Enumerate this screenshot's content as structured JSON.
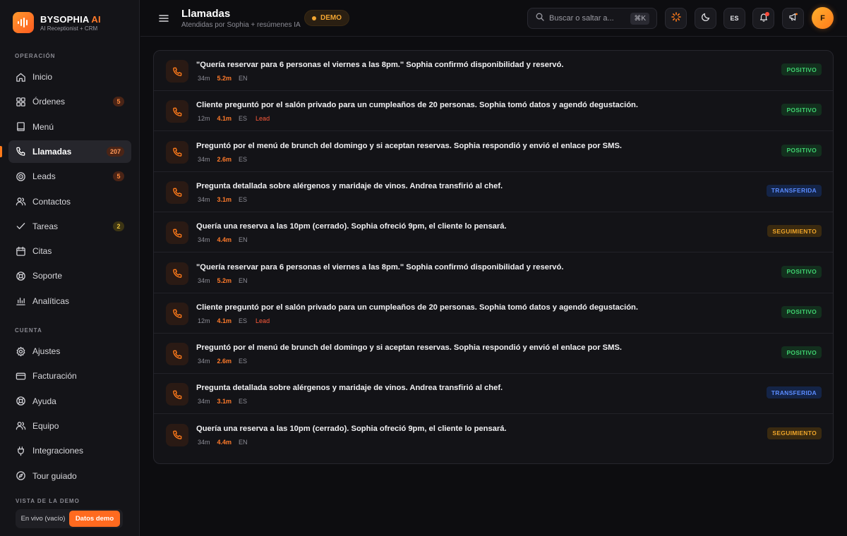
{
  "brand": {
    "name": "BYSOPHIA",
    "name_accent": "AI",
    "subtitle": "AI Receptionist + CRM"
  },
  "sidebar": {
    "section_operacion": "OPERACIÓN",
    "section_cuenta": "CUENTA",
    "section_demo": "VISTA DE LA DEMO",
    "items": [
      {
        "label": "Inicio",
        "icon": "home-icon"
      },
      {
        "label": "Órdenes",
        "icon": "grid-icon",
        "badge": "5"
      },
      {
        "label": "Menú",
        "icon": "book-icon"
      },
      {
        "label": "Llamadas",
        "icon": "phone-icon",
        "badge": "207",
        "active": true
      },
      {
        "label": "Leads",
        "icon": "target-icon",
        "badge": "5"
      },
      {
        "label": "Contactos",
        "icon": "users-icon"
      },
      {
        "label": "Tareas",
        "icon": "check-icon",
        "badge": "2"
      },
      {
        "label": "Citas",
        "icon": "calendar-icon"
      },
      {
        "label": "Soporte",
        "icon": "lifebuoy-icon"
      },
      {
        "label": "Analíticas",
        "icon": "chart-icon"
      }
    ],
    "account_items": [
      {
        "label": "Ajustes",
        "icon": "gear-icon"
      },
      {
        "label": "Facturación",
        "icon": "credit-card-icon"
      },
      {
        "label": "Ayuda",
        "icon": "help-icon"
      },
      {
        "label": "Equipo",
        "icon": "team-icon"
      },
      {
        "label": "Integraciones",
        "icon": "plug-icon"
      },
      {
        "label": "Tour guiado",
        "icon": "compass-icon"
      }
    ],
    "demo_toggle": {
      "off_label": "En vivo (vacío)",
      "on_label": "Datos demo"
    }
  },
  "header": {
    "title": "Llamadas",
    "subtitle": "Atendidas por Sophia + resúmenes IA",
    "demo_badge": "DEMO",
    "search_placeholder": "Buscar o saltar a...",
    "search_shortcut": "⌘K",
    "language": "ES",
    "avatar_initial": "F"
  },
  "calls": [
    {
      "summary": "\"Quería reservar para 6 personas el viernes a las 8pm.\" Sophia confirmó disponibilidad y reservó.",
      "ago": "34m",
      "length": "5.2m",
      "lang": "EN",
      "tag": "",
      "status": "POSITIVO",
      "status_kind": "positivo"
    },
    {
      "summary": "Cliente preguntó por el salón privado para un cumpleaños de 20 personas. Sophia tomó datos y agendó degustación.",
      "ago": "12m",
      "length": "4.1m",
      "lang": "ES",
      "tag": "Lead",
      "status": "POSITIVO",
      "status_kind": "positivo"
    },
    {
      "summary": "Preguntó por el menú de brunch del domingo y si aceptan reservas. Sophia respondió y envió el enlace por SMS.",
      "ago": "34m",
      "length": "2.6m",
      "lang": "ES",
      "tag": "",
      "status": "POSITIVO",
      "status_kind": "positivo"
    },
    {
      "summary": "Pregunta detallada sobre alérgenos y maridaje de vinos. Andrea transfirió al chef.",
      "ago": "34m",
      "length": "3.1m",
      "lang": "ES",
      "tag": "",
      "status": "TRANSFERIDA",
      "status_kind": "transferida"
    },
    {
      "summary": "Quería una reserva a las 10pm (cerrado). Sophia ofreció 9pm, el cliente lo pensará.",
      "ago": "34m",
      "length": "4.4m",
      "lang": "EN",
      "tag": "",
      "status": "SEGUIMIENTO",
      "status_kind": "seguimiento"
    },
    {
      "summary": "\"Quería reservar para 6 personas el viernes a las 8pm.\" Sophia confirmó disponibilidad y reservó.",
      "ago": "34m",
      "length": "5.2m",
      "lang": "EN",
      "tag": "",
      "status": "POSITIVO",
      "status_kind": "positivo"
    },
    {
      "summary": "Cliente preguntó por el salón privado para un cumpleaños de 20 personas. Sophia tomó datos y agendó degustación.",
      "ago": "12m",
      "length": "4.1m",
      "lang": "ES",
      "tag": "Lead",
      "status": "POSITIVO",
      "status_kind": "positivo"
    },
    {
      "summary": "Preguntó por el menú de brunch del domingo y si aceptan reservas. Sophia respondió y envió el enlace por SMS.",
      "ago": "34m",
      "length": "2.6m",
      "lang": "ES",
      "tag": "",
      "status": "POSITIVO",
      "status_kind": "positivo"
    },
    {
      "summary": "Pregunta detallada sobre alérgenos y maridaje de vinos. Andrea transfirió al chef.",
      "ago": "34m",
      "length": "3.1m",
      "lang": "ES",
      "tag": "",
      "status": "TRANSFERIDA",
      "status_kind": "transferida"
    },
    {
      "summary": "Quería una reserva a las 10pm (cerrado). Sophia ofreció 9pm, el cliente lo pensará.",
      "ago": "34m",
      "length": "4.4m",
      "lang": "EN",
      "tag": "",
      "status": "SEGUIMIENTO",
      "status_kind": "seguimiento"
    }
  ],
  "colors": {
    "accent": "#ff7a1a",
    "positive": "#3fd16f",
    "transferred": "#5b8cff",
    "followup": "#f0a62a"
  }
}
